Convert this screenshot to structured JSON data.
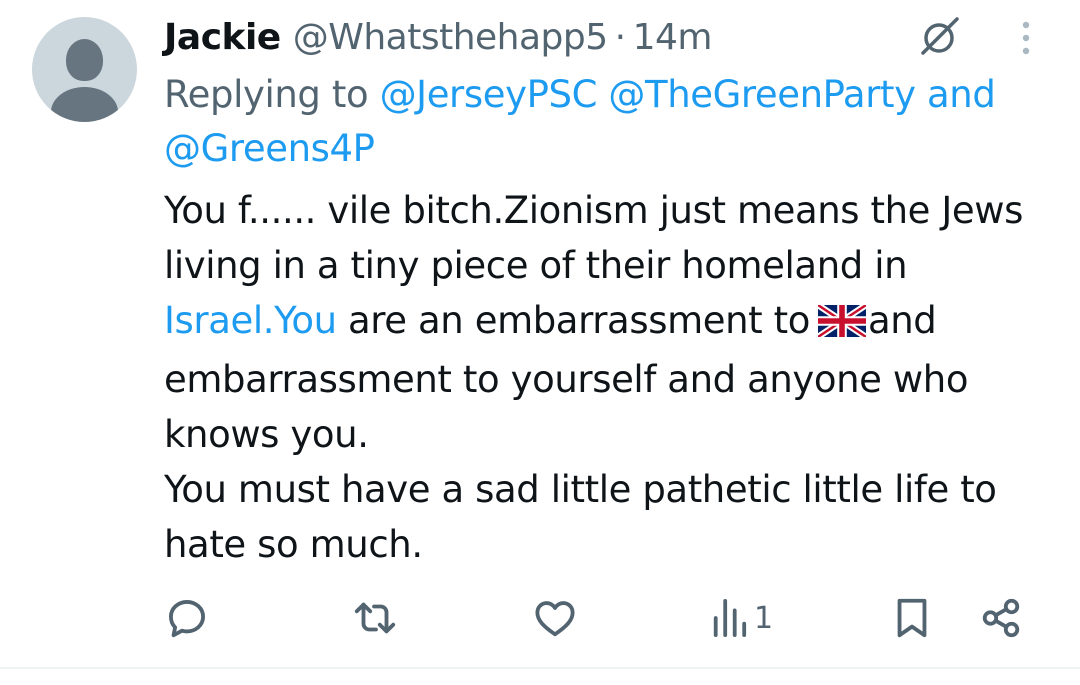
{
  "tweet": {
    "author_name": "Jackie",
    "handle": "@Whatsthehapp5",
    "separator": "·",
    "time": "14m",
    "reply": {
      "prefix": "Replying to",
      "mention_1": "@JerseyPSC",
      "mention_2": "@TheGreenParty",
      "conjunction": "and",
      "mention_3": "@Greens4P"
    },
    "body": {
      "line_1": "You f...... vile bitch.Zionism just means the Jews living in a tiny piece of their homeland in",
      "link": "Israel.You",
      "after_link": "are an embarrassment to",
      "flag_emoji": "🇬🇧",
      "after_flag": "and embarrassment to yourself and anyone who knows you.",
      "paragraph_2": "You must have a sad little pathetic little life to hate so much."
    }
  },
  "actions": {
    "reply_icon": "reply-icon",
    "retweet_icon": "retweet-icon",
    "like_icon": "heart-icon",
    "views_icon": "views-icon",
    "views_count": "1",
    "bookmark_icon": "bookmark-icon",
    "share_icon": "share-icon"
  },
  "colors": {
    "text": "#0f1419",
    "secondary": "#536471",
    "accent": "#1d9bf0",
    "avatar_bg": "#ccd6dd",
    "avatar_fg": "#66757f"
  }
}
